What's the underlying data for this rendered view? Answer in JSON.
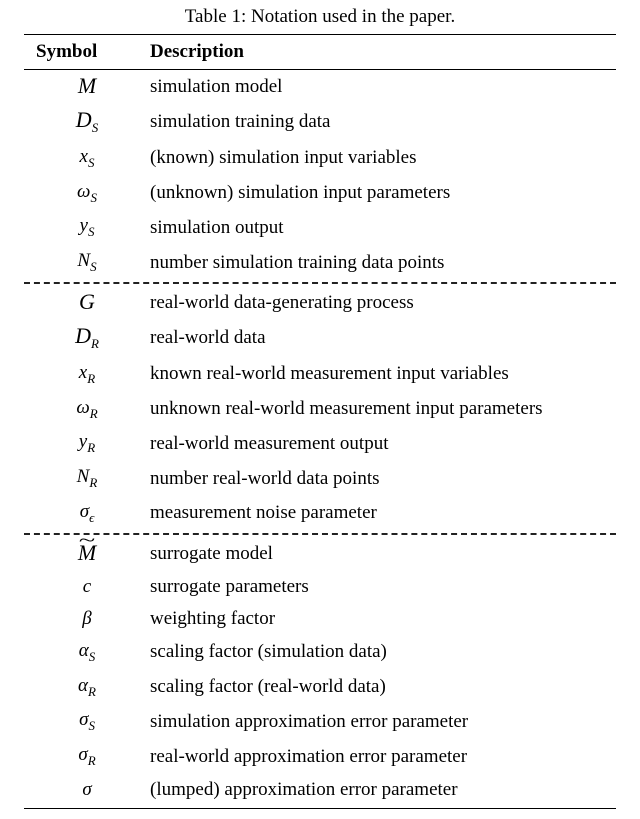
{
  "caption": "Table 1: Notation used in the paper.",
  "headers": {
    "symbol": "Symbol",
    "description": "Description"
  },
  "groups": [
    {
      "rows": [
        {
          "desc": "simulation model"
        },
        {
          "desc": "simulation training data"
        },
        {
          "desc": "(known) simulation input variables"
        },
        {
          "desc": "(unknown) simulation input parameters"
        },
        {
          "desc": "simulation output"
        },
        {
          "desc": "number simulation training data points"
        }
      ]
    },
    {
      "rows": [
        {
          "desc": "real-world data-generating process"
        },
        {
          "desc": "real-world data"
        },
        {
          "desc": "known real-world measurement input variables"
        },
        {
          "desc": "unknown real-world measurement input parameters"
        },
        {
          "desc": "real-world measurement output"
        },
        {
          "desc": "number real-world data points"
        },
        {
          "desc": "measurement noise parameter"
        }
      ]
    },
    {
      "rows": [
        {
          "desc": "surrogate model"
        },
        {
          "desc": "surrogate parameters"
        },
        {
          "desc": "weighting factor"
        },
        {
          "desc": "scaling factor (simulation data)"
        },
        {
          "desc": "scaling factor (real-world data)"
        },
        {
          "desc": "simulation approximation error parameter"
        },
        {
          "desc": "real-world approximation error parameter"
        },
        {
          "desc": "(lumped) approximation error parameter"
        }
      ]
    }
  ],
  "chart_data": {
    "type": "table",
    "title": "Notation used in the paper.",
    "columns": [
      "Symbol",
      "Description"
    ],
    "rows": [
      [
        "ℳ",
        "simulation model"
      ],
      [
        "𝒟_S",
        "simulation training data"
      ],
      [
        "x_S",
        "(known) simulation input variables"
      ],
      [
        "ω_S",
        "(unknown) simulation input parameters"
      ],
      [
        "y_S",
        "simulation output"
      ],
      [
        "N_S",
        "number simulation training data points"
      ],
      [
        "𝒢",
        "real-world data-generating process"
      ],
      [
        "𝒟_R",
        "real-world data"
      ],
      [
        "x_R",
        "known real-world measurement input variables"
      ],
      [
        "ω_R",
        "unknown real-world measurement input parameters"
      ],
      [
        "y_R",
        "real-world measurement output"
      ],
      [
        "N_R",
        "number real-world data points"
      ],
      [
        "σ_ε",
        "measurement noise parameter"
      ],
      [
        "ℳ̃",
        "surrogate model"
      ],
      [
        "c",
        "surrogate parameters"
      ],
      [
        "β",
        "weighting factor"
      ],
      [
        "α_S",
        "scaling factor (simulation data)"
      ],
      [
        "α_R",
        "scaling factor (real-world data)"
      ],
      [
        "σ_S",
        "simulation approximation error parameter"
      ],
      [
        "σ_R",
        "real-world approximation error parameter"
      ],
      [
        "σ",
        "(lumped) approximation error parameter"
      ]
    ]
  }
}
